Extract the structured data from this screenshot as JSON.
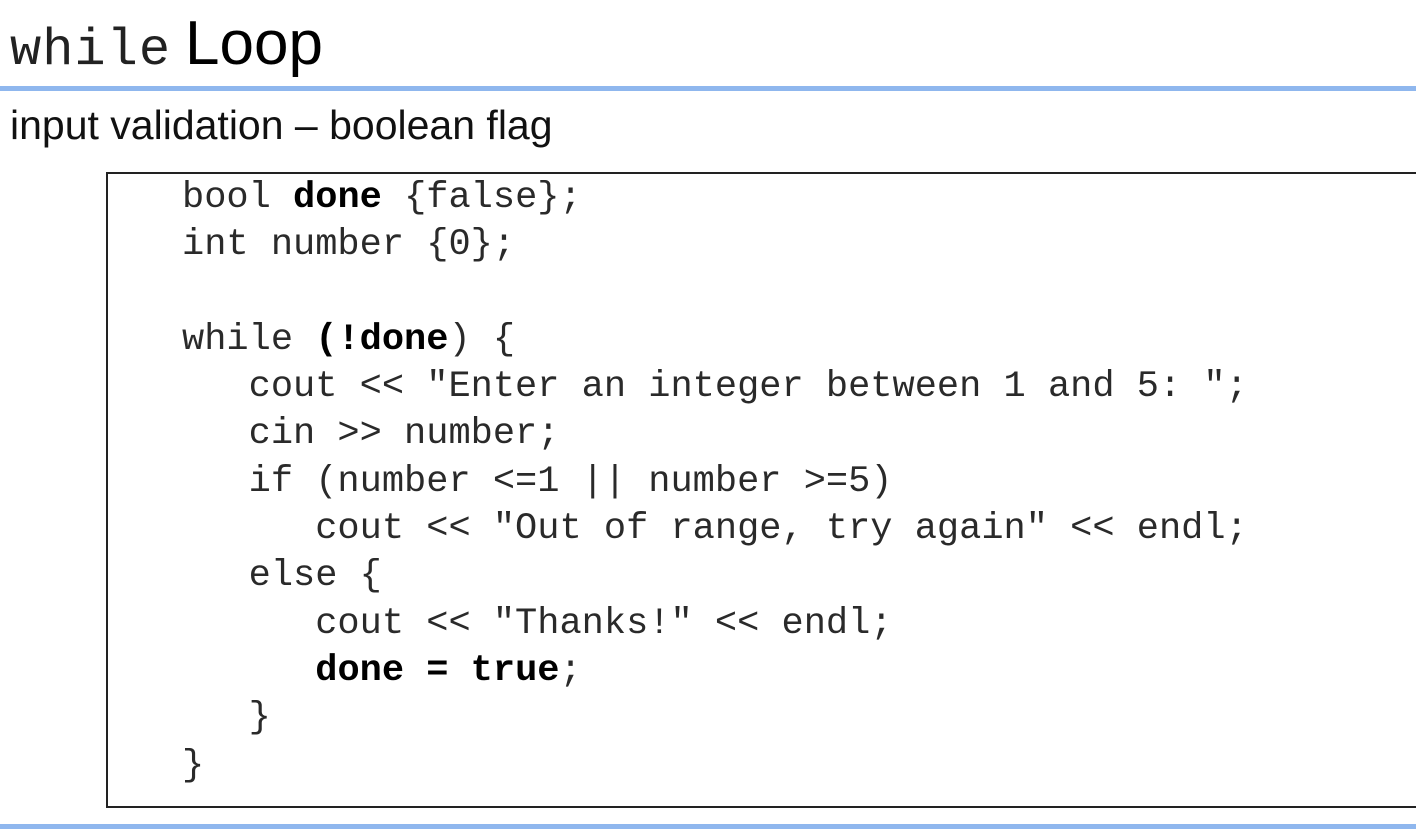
{
  "slide": {
    "title_code": "while",
    "title_text": "Loop",
    "subtitle": "input validation – boolean flag",
    "accent_color": "#8fb7ee"
  },
  "code": {
    "lines": [
      [
        "bool ",
        "done",
        " {false};"
      ],
      [
        "int number {0};"
      ],
      [
        ""
      ],
      [
        "while ",
        "(!done",
        ") {"
      ],
      [
        "   cout << \"Enter an integer between 1 and 5: \";"
      ],
      [
        "   cin >> number;"
      ],
      [
        "   if (number <=1 || number >=5)"
      ],
      [
        "      cout << \"Out of range, try again\" << endl;"
      ],
      [
        "   else {"
      ],
      [
        "      cout << \"Thanks!\" << endl;"
      ],
      [
        "      ",
        "done = true",
        ";"
      ],
      [
        "   }"
      ],
      [
        "}"
      ]
    ]
  }
}
